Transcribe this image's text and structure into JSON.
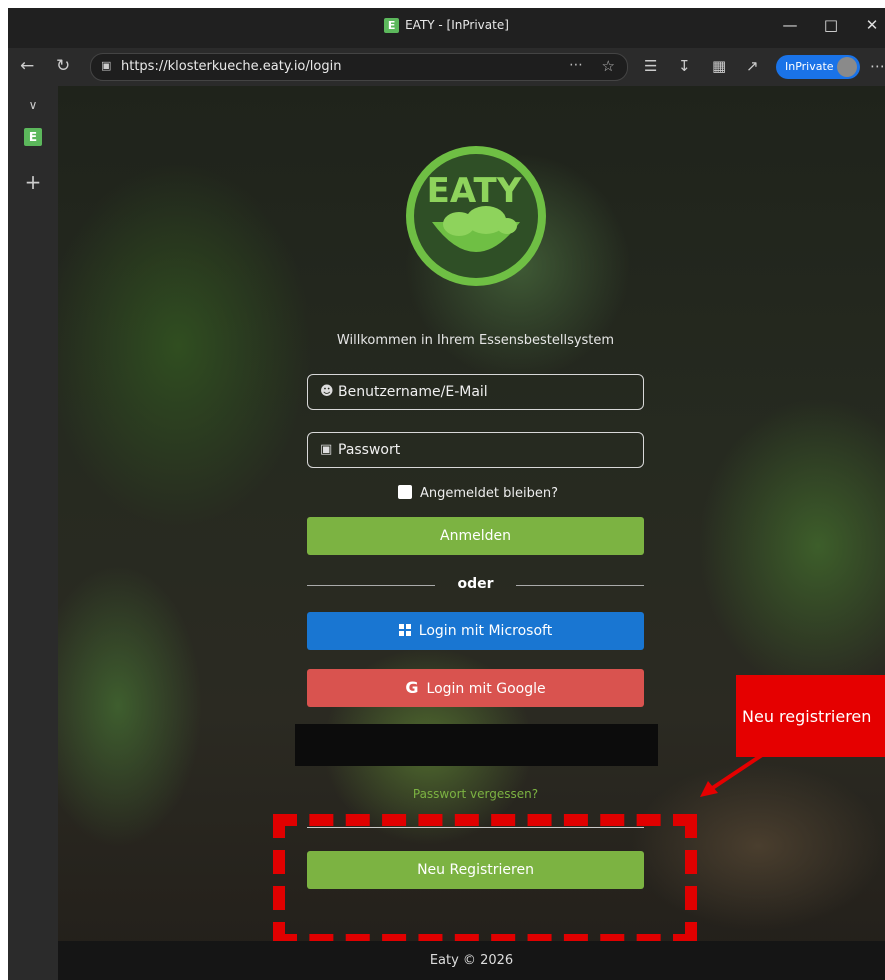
{
  "window": {
    "title": "EATY - [InPrivate]",
    "app_icon_letter": "E",
    "controls": [
      "minimize-icon",
      "maximize-icon",
      "close-icon"
    ]
  },
  "addressbar": {
    "url": "https://klosterkueche.eaty.io/login",
    "inprivate_label": "InPrivate"
  },
  "sidebar": {
    "tab_letter": "E"
  },
  "logo": {
    "text": "EATY"
  },
  "login": {
    "welcome": "Willkommen in Ihrem Essensbestellsystem",
    "username_placeholder": "Benutzername/E-Mail",
    "password_placeholder": "Passwort",
    "remember_label": "Angemeldet bleiben?",
    "login_button": "Anmelden",
    "divider": "oder",
    "microsoft_button": "Login mit Microsoft",
    "google_button": "Login mit Google",
    "forgot_link": "Passwort vergessen?",
    "register_button": "Neu Registrieren"
  },
  "footer": {
    "text": "Eaty © 2026"
  },
  "annotation": {
    "callout": "Neu registrieren"
  },
  "colors": {
    "accent_green": "#7cb342",
    "microsoft_blue": "#1976d2",
    "google_red": "#d9534f",
    "annotation_red": "#e50000"
  }
}
